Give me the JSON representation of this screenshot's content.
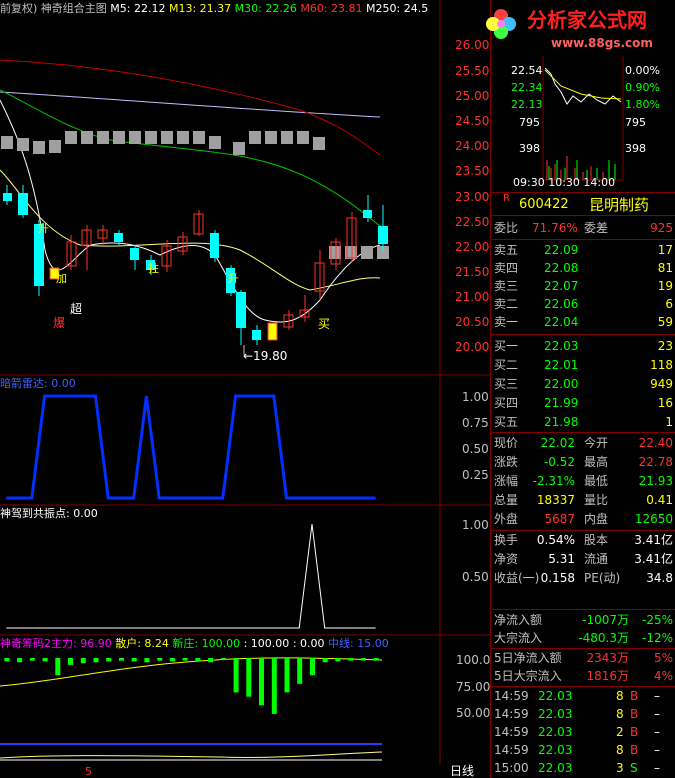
{
  "main_legend": {
    "prefix": "前复权)",
    "name": "神奇组合主图",
    "ma5": "M5: 22.12",
    "ma13": "M13: 21.37",
    "ma30": "M30: 22.26",
    "ma60": "M60: 23.81",
    "ma250": "M250: 24.5"
  },
  "price_axis": [
    "26.00",
    "25.50",
    "25.00",
    "24.50",
    "24.00",
    "23.50",
    "23.00",
    "22.50",
    "22.00",
    "21.50",
    "21.00",
    "20.50",
    "20.00"
  ],
  "annotations": {
    "chao": "超",
    "bao": "爆",
    "mai": "买",
    "low_label": "←19.80",
    "sheng1": "升",
    "jia": "加",
    "sheng2": "升",
    "zhu": "拄"
  },
  "ind1": {
    "legend": "暗箭雷达: 0.00",
    "axis": [
      "1.00",
      "0.75",
      "0.50",
      "0.25"
    ],
    "chart_data": {
      "type": "line",
      "series": [
        {
          "values": [
            0,
            0,
            0,
            1,
            1,
            1,
            1,
            1,
            0,
            0,
            0,
            1,
            0,
            0,
            0,
            0,
            0,
            0,
            1,
            1,
            1,
            1,
            0,
            0,
            0,
            0,
            0,
            0,
            0,
            0
          ]
        }
      ],
      "ylim": [
        0,
        1
      ]
    }
  },
  "ind2": {
    "legend": "神驾到共振点: 0.00",
    "axis": [
      "1.00",
      "0.50"
    ],
    "chart_data": {
      "type": "line",
      "series": [
        {
          "values": [
            0,
            0,
            0,
            0,
            0,
            0,
            0,
            0,
            0,
            0,
            0,
            0,
            0,
            0,
            0,
            0,
            0,
            0,
            0,
            0,
            0,
            0,
            0,
            0,
            1,
            0,
            0,
            0,
            0,
            0
          ]
        }
      ],
      "ylim": [
        0,
        1
      ]
    }
  },
  "ind3": {
    "legend1": "神奇筹码2主力: 96.90",
    "legend2": "散户: 8.24",
    "legend3": "新庄: 100.00",
    "legend4": ": 100.00",
    "legend5": ": 0.00",
    "legend6": "中线: 15.00",
    "axis": [
      "100.0",
      "75.00",
      "50.00"
    ],
    "chart_data": {
      "type": "bar",
      "series": [
        {
          "name": "主力",
          "values": [
            96,
            95,
            97,
            96,
            80,
            92,
            94,
            95,
            96,
            97,
            96,
            95,
            97,
            96,
            97,
            96,
            95,
            98,
            60,
            55,
            45,
            35,
            60,
            70,
            80,
            95,
            96,
            97,
            97,
            97
          ]
        }
      ],
      "ylim": [
        0,
        100
      ]
    }
  },
  "bottom": {
    "tick": "5",
    "period": "日线"
  },
  "logo": {
    "title": "分析家公式网",
    "url": "www.88gs.com"
  },
  "mini_chart": {
    "price_left": [
      "22.54",
      "22.34",
      "22.13",
      "795",
      "398"
    ],
    "pct_right": [
      "0.00%",
      "0.90%",
      "1.80%",
      "795",
      "398"
    ],
    "times": "09:30 10:30 14:00"
  },
  "stock": {
    "flag": "R",
    "code": "600422",
    "name": "昆明制药"
  },
  "weibi": {
    "label": "委比",
    "value": "71.76%",
    "label2": "委差",
    "value2": "925"
  },
  "sell": [
    {
      "label": "卖五",
      "price": "22.09",
      "vol": "17"
    },
    {
      "label": "卖四",
      "price": "22.08",
      "vol": "81"
    },
    {
      "label": "卖三",
      "price": "22.07",
      "vol": "19"
    },
    {
      "label": "卖二",
      "price": "22.06",
      "vol": "6"
    },
    {
      "label": "卖一",
      "price": "22.04",
      "vol": "59"
    }
  ],
  "buy": [
    {
      "label": "买一",
      "price": "22.03",
      "vol": "23"
    },
    {
      "label": "买二",
      "price": "22.01",
      "vol": "118"
    },
    {
      "label": "买三",
      "price": "22.00",
      "vol": "949"
    },
    {
      "label": "买四",
      "price": "21.99",
      "vol": "16"
    },
    {
      "label": "买五",
      "price": "21.98",
      "vol": "1"
    }
  ],
  "quote": [
    {
      "l1": "现价",
      "v1": "22.02",
      "l2": "今开",
      "v2": "22.40"
    },
    {
      "l1": "涨跌",
      "v1": "-0.52",
      "l2": "最高",
      "v2": "22.78"
    },
    {
      "l1": "涨幅",
      "v1": "-2.31%",
      "l2": "最低",
      "v2": "21.93"
    },
    {
      "l1": "总量",
      "v1": "18337",
      "l2": "量比",
      "v2": "0.41"
    },
    {
      "l1": "外盘",
      "v1": "5687",
      "l2": "内盘",
      "v2": "12650"
    }
  ],
  "fin": [
    {
      "l1": "换手",
      "v1": "0.54%",
      "l2": "股本",
      "v2": "3.41亿"
    },
    {
      "l1": "净资",
      "v1": "5.31",
      "l2": "流通",
      "v2": "3.41亿"
    },
    {
      "l1": "收益(一)",
      "v1": "0.158",
      "l2": "PE(动)",
      "v2": "34.8"
    }
  ],
  "flow": [
    {
      "label": "净流入额",
      "value": "-1007万",
      "pct": "-25%"
    },
    {
      "label": "大宗流入",
      "value": "-480.3万",
      "pct": "-12%"
    },
    {
      "label": "5日净流入额",
      "value": "2343万",
      "pct": "5%"
    },
    {
      "label": "5日大宗流入",
      "value": "1816万",
      "pct": "4%"
    }
  ],
  "ticks": [
    {
      "time": "14:59",
      "price": "22.03",
      "vol": "8",
      "side": "B",
      "extra": "–"
    },
    {
      "time": "14:59",
      "price": "22.03",
      "vol": "8",
      "side": "B",
      "extra": "–"
    },
    {
      "time": "14:59",
      "price": "22.03",
      "vol": "2",
      "side": "B",
      "extra": "–"
    },
    {
      "time": "14:59",
      "price": "22.03",
      "vol": "8",
      "side": "B",
      "extra": "–"
    },
    {
      "time": "15:00",
      "price": "22.03",
      "vol": "3",
      "side": "S",
      "extra": "–"
    }
  ],
  "colors": {
    "up": "#00ffff",
    "down": "#ff3030",
    "bg": "#000000",
    "grid": "#800000",
    "ma5": "#ffffff",
    "ma13": "#ffff80",
    "ma30": "#00c000",
    "ma60": "#c00000",
    "ma250": "#c0c0ff"
  }
}
